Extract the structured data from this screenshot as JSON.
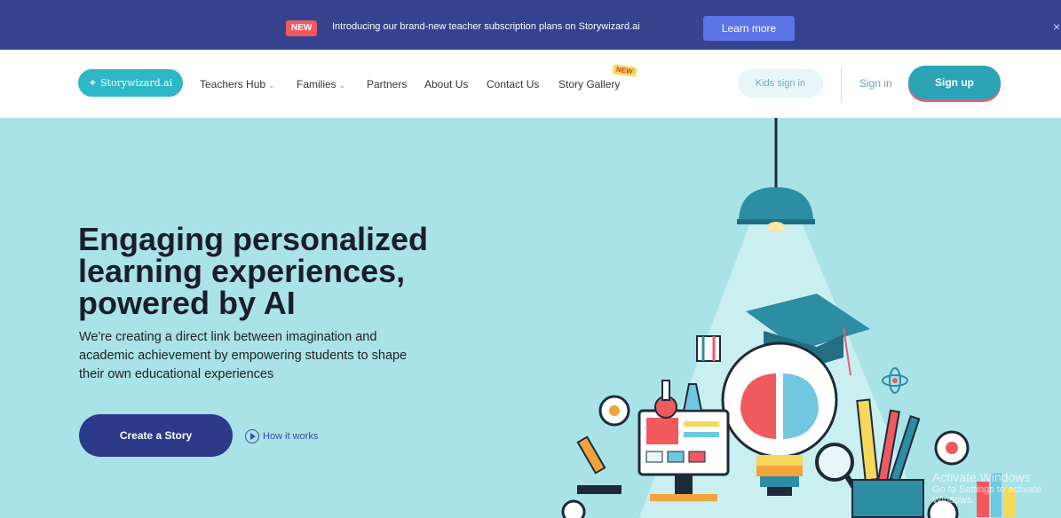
{
  "announcement": {
    "badge": "NEW",
    "message": "Introducing our brand-new teacher subscription plans on Storywizard.ai",
    "learn_more": "Learn more",
    "close_glyph": "×",
    "color": "#34428f"
  },
  "nav": {
    "logo": "Storywizard.ai",
    "items": [
      {
        "label": "Teachers Hub",
        "has_dropdown": true
      },
      {
        "label": "Families",
        "has_dropdown": true
      },
      {
        "label": "Partners"
      },
      {
        "label": "About Us"
      },
      {
        "label": "Contact Us"
      },
      {
        "label": "Story Gallery",
        "badge": "NEW"
      }
    ],
    "kids_sign_in": "Kids sign in",
    "sign_in": "Sign in",
    "sign_up": "Sign up"
  },
  "hero": {
    "title": "Engaging personalized learning experiences, powered by AI",
    "subtitle": "We're creating a direct link between imagination and academic achievement by empowering students to shape their own educational experiences",
    "cta": "Create a Story",
    "how_it_works": "How it works"
  },
  "watermark": {
    "line1": "Activate Windows",
    "line2": "Go to Settings to activate Windows."
  },
  "colors": {
    "background": "#a9e3e8",
    "primary": "#2d3a8a",
    "accent": "#2ba4b6"
  }
}
